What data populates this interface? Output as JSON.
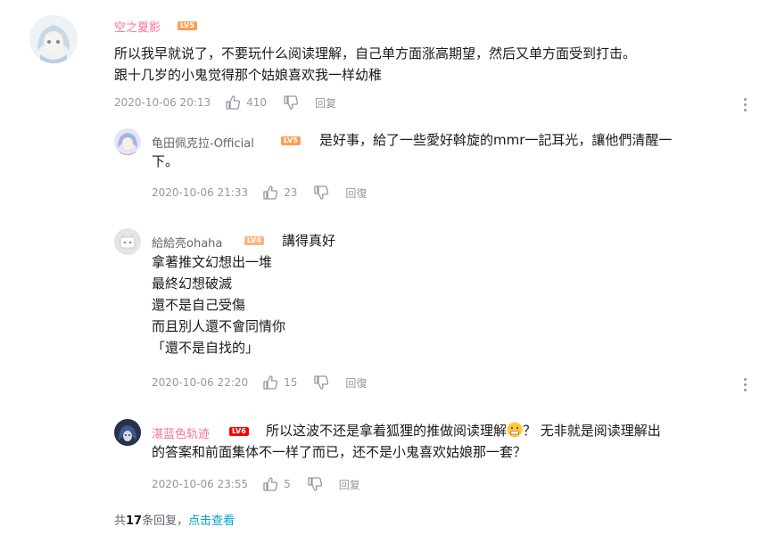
{
  "comment": {
    "username": "空之夏影",
    "level": "LV5",
    "text_line1": "所以我早就说了，不要玩什么阅读理解，自己单方面涨高期望，然后又单方面受到打击。",
    "text_line2": "跟十几岁的小鬼觉得那个姑娘喜欢我一样幼稚",
    "date": "2020-10-06 20:13",
    "likes": "410",
    "reply_label": "回复"
  },
  "replies": [
    {
      "username": "龟田佩克拉-Official",
      "level": "LV5",
      "text_line1": "是好事，給了一些愛好斡旋的mmr一記耳光，讓他們清醒一",
      "text_line2": "下。",
      "date": "2020-10-06 21:33",
      "likes": "23",
      "reply_label": "回復"
    },
    {
      "username": "給給亮ohaha",
      "level": "LV4",
      "lines": [
        "講得真好",
        "拿著推文幻想出一堆",
        "最終幻想破滅",
        "還不是自己受傷",
        "而且別人還不會同情你",
        "「還不是自找的」"
      ],
      "date": "2020-10-06 22:20",
      "likes": "15",
      "reply_label": "回復"
    },
    {
      "username": "湛蓝色轨迹",
      "level": "LV6",
      "text_line1a": "所以这波不还是拿着狐狸的推做阅读理解",
      "text_line1b": "？ 无非就是阅读理解出",
      "text_line2": "的答案和前面集体不一样了而已，还不是小鬼喜欢姑娘那一套？",
      "date": "2020-10-06 23:55",
      "likes": "5",
      "reply_label": "回复"
    }
  ],
  "footer": {
    "prefix": "共",
    "count": "17",
    "suffix": "条回复，",
    "link": "点击查看"
  },
  "colors": {
    "pink_name": "#fb7299",
    "lv5": "#ff9c54",
    "lv4": "#ffb37c",
    "lv6": "#ff0000",
    "link": "#00a1d6"
  }
}
